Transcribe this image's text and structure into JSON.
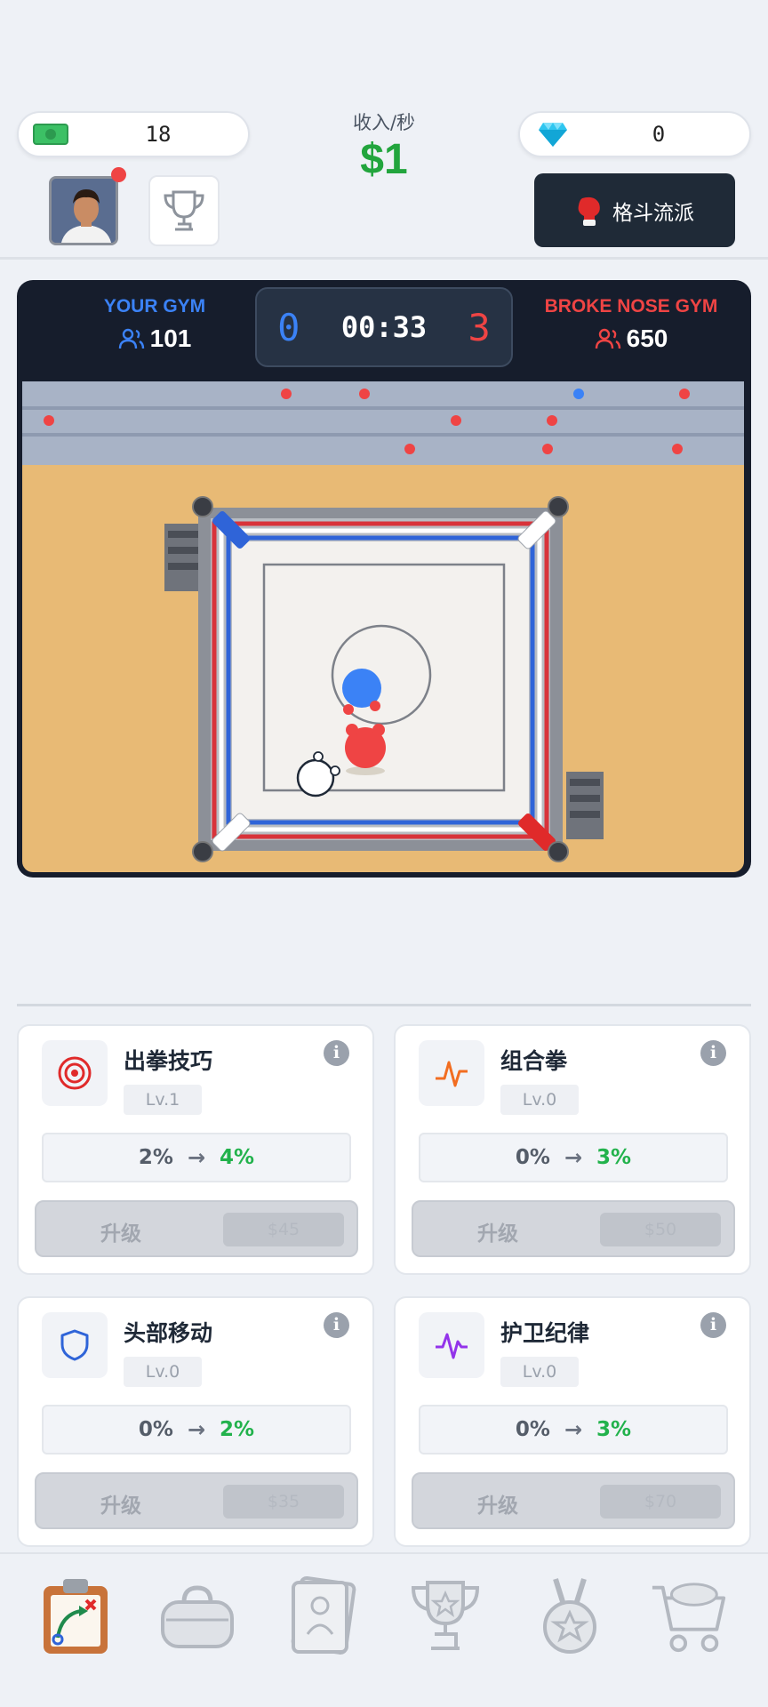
{
  "header": {
    "cash_value": "18",
    "income_label": "收入/秒",
    "income_value": "$1",
    "gem_value": "0",
    "fight_style_label": "格斗流派"
  },
  "arena": {
    "home_team": {
      "name": "YOUR GYM",
      "members": "101",
      "score": "0",
      "color": "#3b82f6"
    },
    "away_team": {
      "name": "BROKE NOSE GYM",
      "members": "650",
      "score": "3",
      "color": "#ef4444"
    },
    "timer": "00:33"
  },
  "upgrades": [
    {
      "title": "出拳技巧",
      "icon": "target-icon",
      "level": "Lv.1",
      "from": "2%",
      "to": "4%",
      "button": "升级",
      "price": "$45"
    },
    {
      "title": "组合拳",
      "icon": "combo-wave-icon",
      "level": "Lv.0",
      "from": "0%",
      "to": "3%",
      "button": "升级",
      "price": "$50"
    },
    {
      "title": "头部移动",
      "icon": "shield-icon",
      "level": "Lv.0",
      "from": "0%",
      "to": "2%",
      "button": "升级",
      "price": "$35"
    },
    {
      "title": "护卫纪律",
      "icon": "pulse-icon",
      "level": "Lv.0",
      "from": "0%",
      "to": "3%",
      "button": "升级",
      "price": "$70"
    }
  ],
  "nav": [
    "strategy-clipboard-icon",
    "gym-bag-icon",
    "cards-icon",
    "trophy-icon",
    "medal-icon",
    "shop-cart-icon"
  ]
}
